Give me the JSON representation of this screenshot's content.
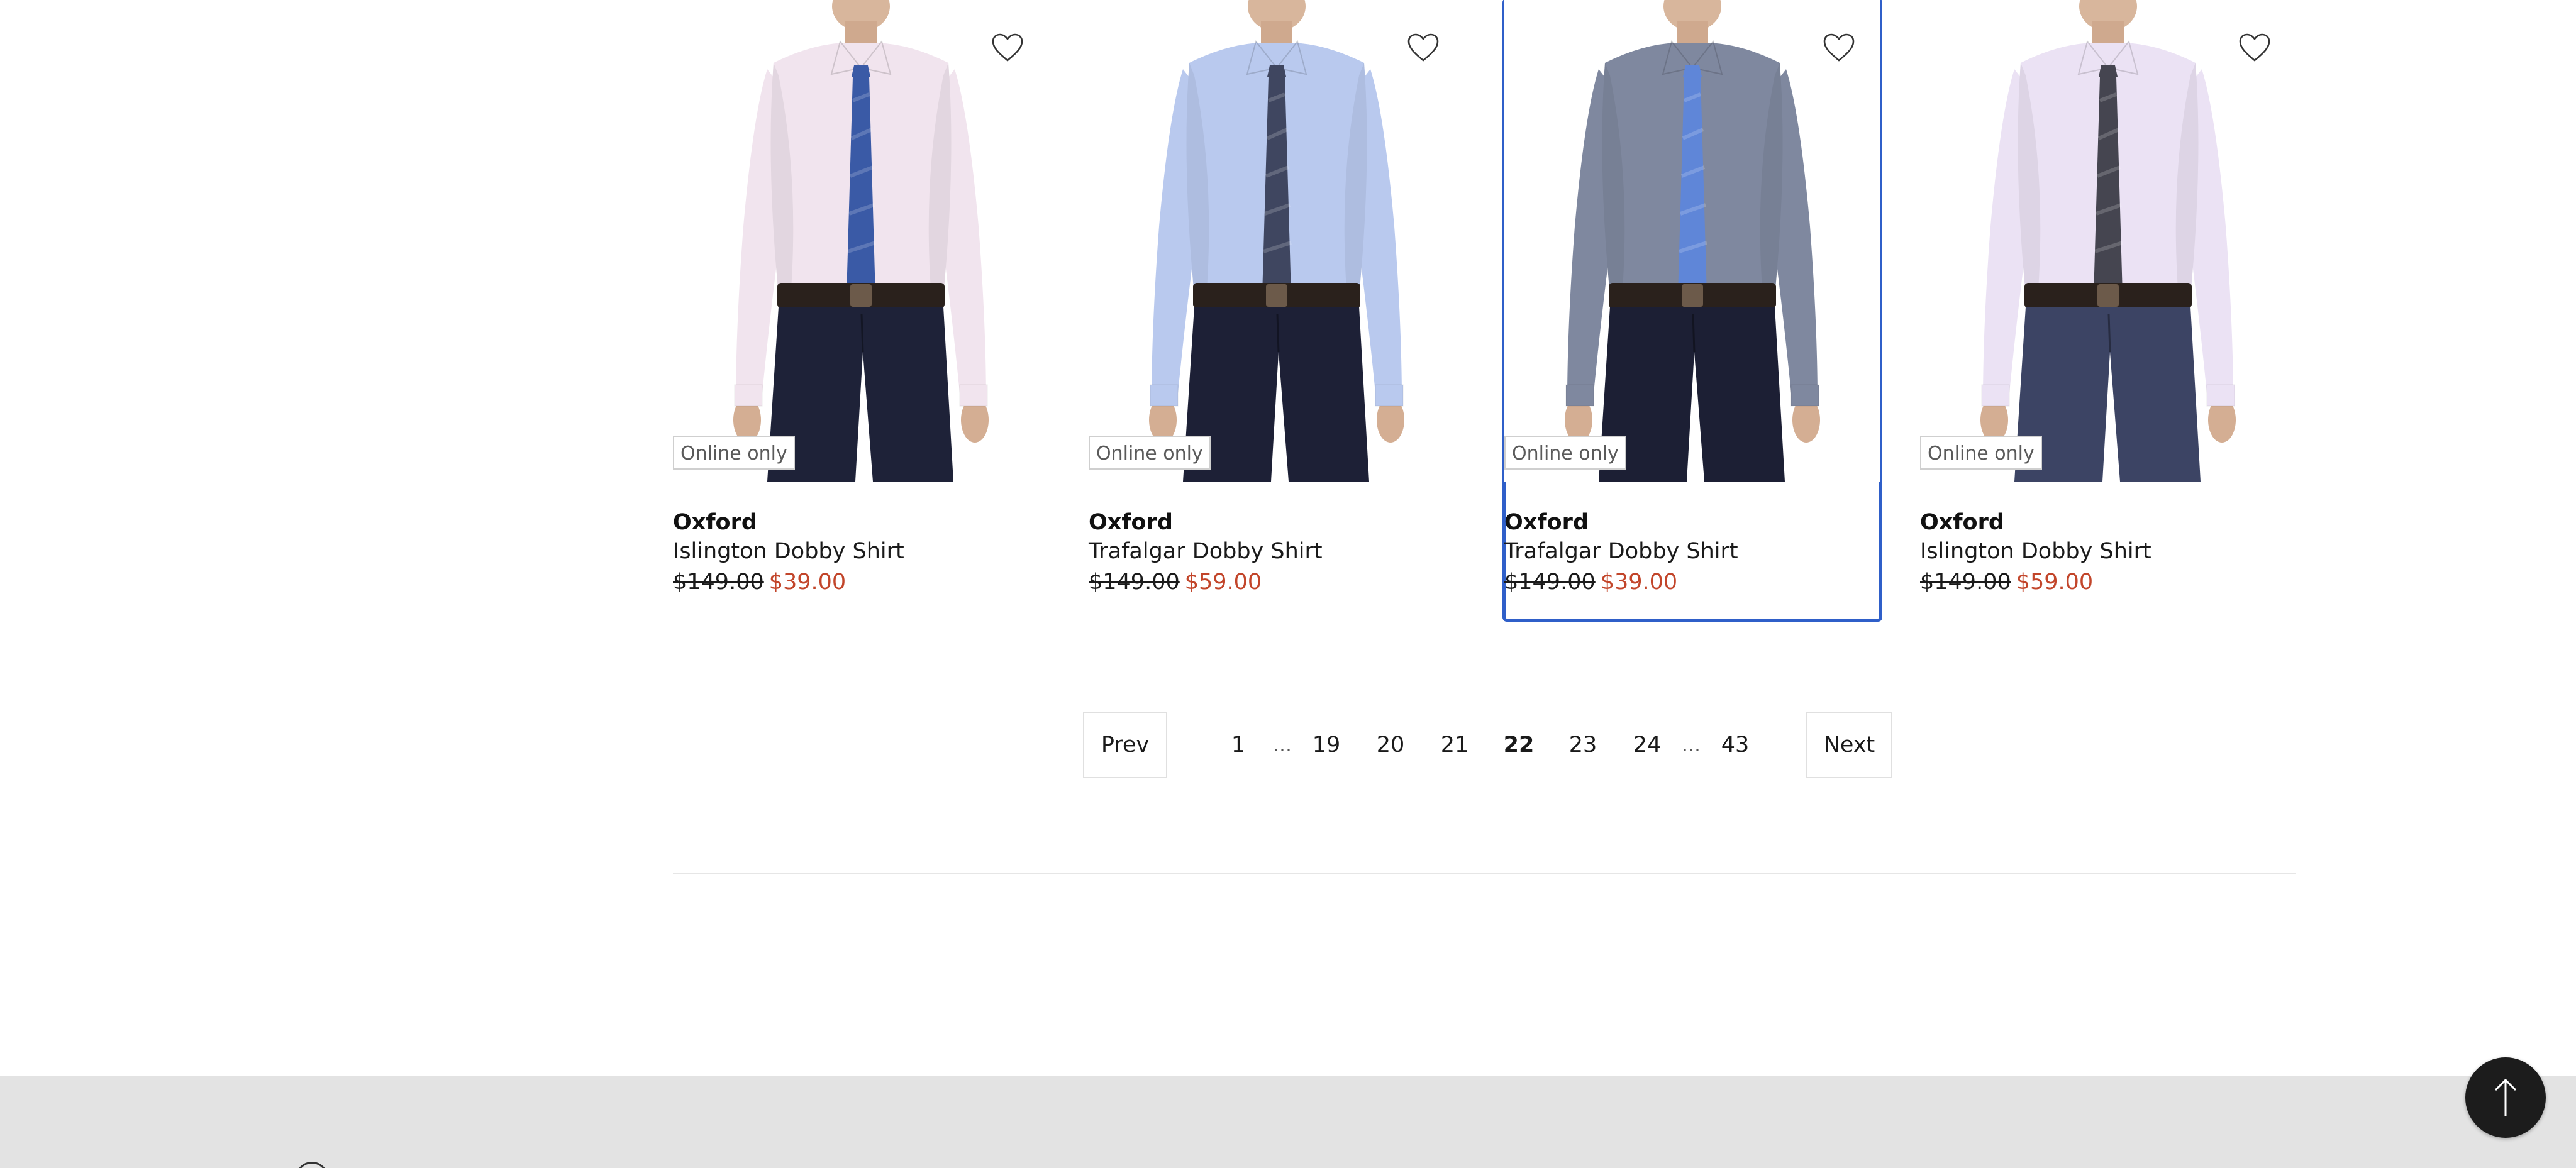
{
  "products": [
    {
      "brand": "Oxford",
      "name": "Islington Dobby Shirt",
      "badge": "Online only",
      "was_price": "$149.00",
      "now_price": "$39.00",
      "shirt_color": "#f1e4ee",
      "tie_color": "#3a5aa6",
      "trouser_color": "#1e2238",
      "focused": false
    },
    {
      "brand": "Oxford",
      "name": "Trafalgar Dobby Shirt",
      "badge": "Online only",
      "was_price": "$149.00",
      "now_price": "$59.00",
      "shirt_color": "#b9c9ee",
      "tie_color": "#3f4660",
      "trouser_color": "#1d2036",
      "focused": false
    },
    {
      "brand": "Oxford",
      "name": "Trafalgar Dobby Shirt",
      "badge": "Online only",
      "was_price": "$149.00",
      "now_price": "$39.00",
      "shirt_color": "#7f889f",
      "tie_color": "#5f86d8",
      "trouser_color": "#1c1f34",
      "focused": true
    },
    {
      "brand": "Oxford",
      "name": "Islington Dobby Shirt",
      "badge": "Online only",
      "was_price": "$149.00",
      "now_price": "$59.00",
      "shirt_color": "#ebe2f4",
      "tie_color": "#454550",
      "trouser_color": "#3c4464",
      "focused": false
    }
  ],
  "pagination": {
    "prev_label": "Prev",
    "next_label": "Next",
    "pages": [
      "1",
      "…",
      "19",
      "20",
      "21",
      "22",
      "23",
      "24",
      "…",
      "43"
    ],
    "current": "22"
  },
  "icons": {
    "wishlist": "heart-outline-icon",
    "back_to_top": "arrow-up-icon"
  },
  "colors": {
    "sale_price": "#c2452a",
    "focus_outline": "#2f5fc9",
    "footer_bg": "#e3e3e3",
    "back_to_top_bg": "#1c1c1c"
  }
}
